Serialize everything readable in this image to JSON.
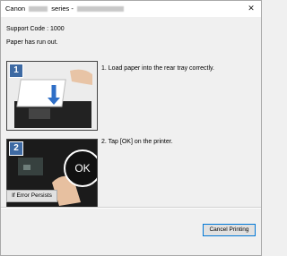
{
  "window": {
    "title_prefix": "Canon",
    "title_series": "series -"
  },
  "content": {
    "support_code": "Support Code : 1000",
    "message": "Paper has run out.",
    "steps": [
      {
        "number": "1",
        "text": "1.   Load paper into the rear tray correctly."
      },
      {
        "number": "2",
        "text": "2.   Tap [OK] on the printer.",
        "bubble": "OK"
      }
    ]
  },
  "buttons": {
    "error_persists": "If Error Persists",
    "cancel_printing": "Cancel Printing"
  },
  "icons": {
    "close": "close-icon"
  }
}
